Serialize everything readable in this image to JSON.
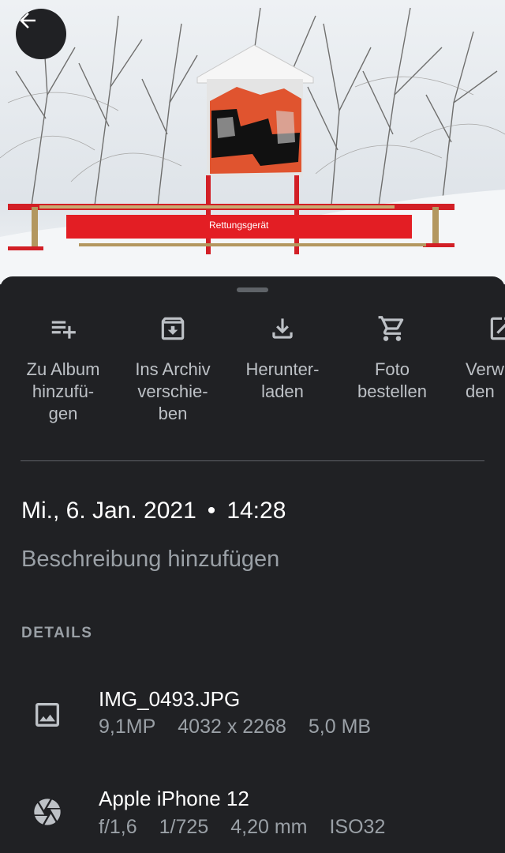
{
  "photo": {
    "sign_text": "Rettungsgerät"
  },
  "actions": [
    {
      "icon": "playlist-add-icon",
      "label": "Zu Album\nhinzufü-\ngen"
    },
    {
      "icon": "archive-icon",
      "label": "Ins Archiv\nverschie-\nben"
    },
    {
      "icon": "download-icon",
      "label": "Herunter-\nladen"
    },
    {
      "icon": "cart-icon",
      "label": "Foto\nbestellen"
    },
    {
      "icon": "open-external-icon",
      "label": "Verw\nden"
    }
  ],
  "datetime": {
    "date": "Mi., 6. Jan. 2021",
    "separator": "•",
    "time": "14:28"
  },
  "description_placeholder": "Beschreibung hinzufügen",
  "details": {
    "heading": "DETAILS",
    "file": {
      "icon": "image-icon",
      "name": "IMG_0493.JPG",
      "megapixels": "9,1MP",
      "resolution": "4032 x 2268",
      "size": "5,0 MB"
    },
    "camera": {
      "icon": "aperture-icon",
      "model": "Apple iPhone 12",
      "aperture": "f/1,6",
      "shutter": "1/725",
      "focal_length": "4,20 mm",
      "iso": "ISO32"
    }
  },
  "colors": {
    "background": "#202124",
    "text_primary": "#ffffff",
    "text_secondary": "#9aa0a6",
    "sign_red": "#e31e24"
  }
}
